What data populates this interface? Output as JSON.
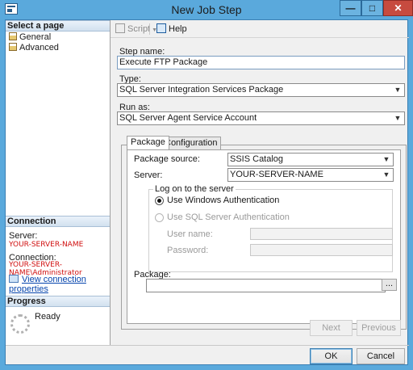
{
  "window": {
    "title": "New Job Step"
  },
  "left": {
    "select_page_header": "Select a page",
    "pages": [
      "General",
      "Advanced"
    ],
    "connection_header": "Connection",
    "server_label": "Server:",
    "server_value": "YOUR-SERVER-NAME",
    "connection_label": "Connection:",
    "connection_value": "YOUR-SERVER-NAME\\Administrator",
    "view_connection_link": "View connection properties",
    "progress_header": "Progress",
    "progress_status": "Ready"
  },
  "toolbar": {
    "script_label": "Script",
    "help_label": "Help"
  },
  "form": {
    "step_name_label": "Step name:",
    "step_name_value": "Execute FTP Package",
    "type_label": "Type:",
    "type_value": "SQL Server Integration Services Package",
    "run_as_label": "Run as:",
    "run_as_value": "SQL Server Agent Service Account"
  },
  "tabs": [
    "Package",
    "Configuration"
  ],
  "package_tab": {
    "source_label": "Package source:",
    "source_value": "SSIS Catalog",
    "server_label": "Server:",
    "server_value": "YOUR-SERVER-NAME",
    "logon_group_title": "Log on to the server",
    "windows_auth_label": "Use Windows Authentication",
    "sql_auth_label": "Use SQL Server Authentication",
    "username_label": "User name:",
    "password_label": "Password:",
    "package_label": "Package:",
    "package_value": "",
    "browse_label": "..."
  },
  "buttons": {
    "next": "Next",
    "previous": "Previous",
    "ok": "OK",
    "cancel": "Cancel"
  },
  "colors": {
    "titlebar": "#5aa9dc",
    "link": "#0645ad",
    "server_red": "#d01010"
  }
}
